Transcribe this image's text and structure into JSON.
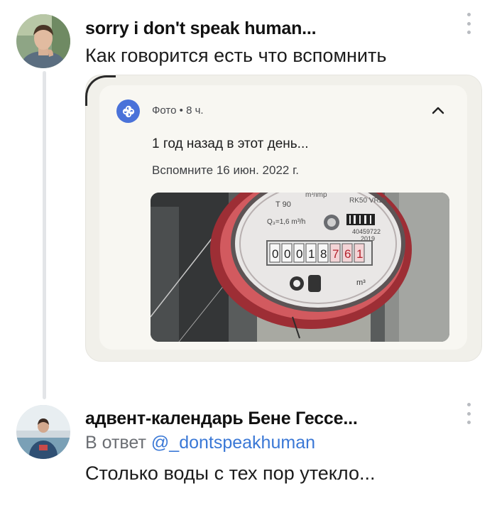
{
  "post1": {
    "author": "sorry i don't speak human...",
    "text": "Как говорится есть что вспомнить"
  },
  "notification": {
    "app": "Фото",
    "time_sep": "•",
    "time": "8 ч.",
    "title": "1 год назад в этот день...",
    "subtitle": "Вспомните 16 июн. 2022 г."
  },
  "photo_text": {
    "temp": "T 90",
    "flow": "Q₃=1,6 m³/h",
    "imp": "m³/imp",
    "model": "RK50 VR25",
    "serial": "40459722",
    "year": "2019",
    "digits": [
      "0",
      "0",
      "0",
      "1",
      "8",
      "7",
      "6",
      "1"
    ],
    "unit": "m³"
  },
  "post2": {
    "author": "адвент-календарь Бене Гессе...",
    "reply_prefix": "В ответ",
    "reply_handle": "@_dontspeakhuman",
    "text": "Столько воды с тех пор утекло..."
  },
  "icons": {
    "app_icon": "pinwheel-icon",
    "collapse": "chevron-up-icon",
    "menu": "kebab-icon"
  },
  "colors": {
    "mention": "#3a78d6",
    "app_icon_bg": "#4a72d9",
    "meter_red": "#c0434a"
  }
}
